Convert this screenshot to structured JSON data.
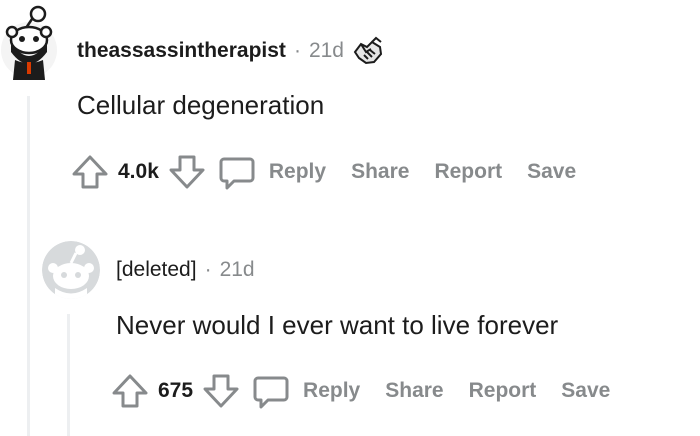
{
  "comments": [
    {
      "username": "theassassintherapist",
      "separator": "·",
      "time": "21d",
      "award_icon": "handshake-award-icon",
      "body": "Cellular degeneration",
      "score": "4.0k",
      "actions": {
        "reply": "Reply",
        "share": "Share",
        "report": "Report",
        "save": "Save"
      }
    },
    {
      "username": "[deleted]",
      "separator": "·",
      "time": "21d",
      "body": "Never would I ever want to live forever",
      "score": "675",
      "actions": {
        "reply": "Reply",
        "share": "Share",
        "report": "Report",
        "save": "Save"
      }
    }
  ],
  "colors": {
    "text": "#1c1c1c",
    "muted": "#878a8c",
    "thread_line": "#edeff1"
  },
  "icons": [
    "upvote-icon",
    "downvote-icon",
    "comment-bubble-icon",
    "snoo-avatar-icon",
    "deleted-avatar-icon"
  ]
}
